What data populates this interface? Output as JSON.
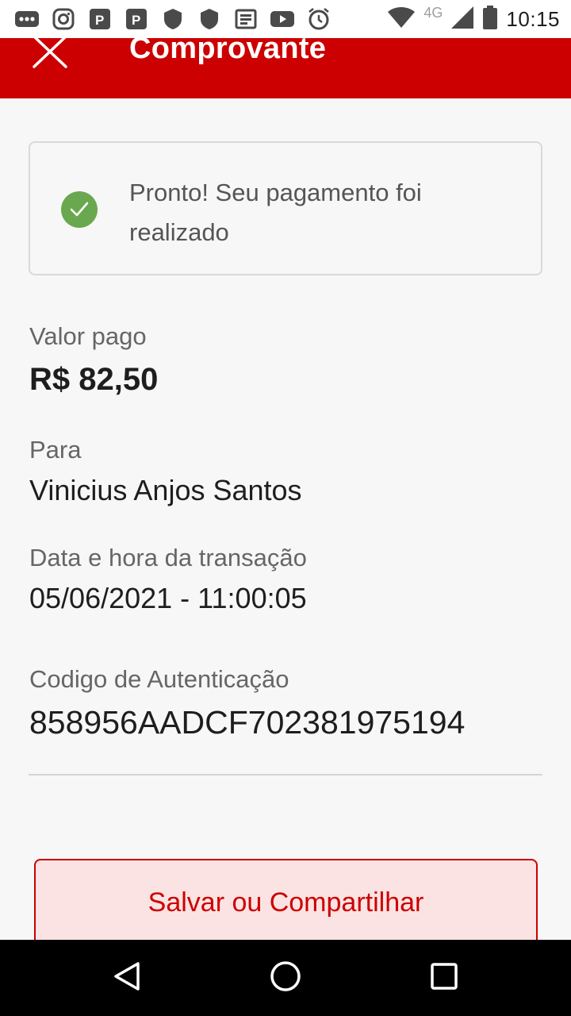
{
  "status_bar": {
    "time": "10:15",
    "network": "4G",
    "icons": [
      "more-dots-icon",
      "instagram-icon",
      "parking-icon",
      "parking-icon",
      "shield-icon",
      "shield-icon",
      "news-icon",
      "youtube-icon",
      "alarm-icon",
      "wifi-icon",
      "signal-icon",
      "battery-icon"
    ]
  },
  "header": {
    "title": "Comprovante",
    "close_icon": "close-icon",
    "color": "#cc0000"
  },
  "success": {
    "message": "Pronto! Seu pagamento foi realizado",
    "icon": "check-circle-icon",
    "icon_color": "#6aa84f"
  },
  "details": {
    "amount_label": "Valor pago",
    "amount_value": "R$ 82,50",
    "recipient_label": "Para",
    "recipient_value": "Vinicius Anjos Santos",
    "datetime_label": "Data e hora da transação",
    "datetime_value": "05/06/2021 - 11:00:05",
    "auth_label": "Codigo de Autenticação",
    "auth_value": "858956AADCF702381975194"
  },
  "actions": {
    "share_label": "Salvar ou Compartilhar"
  },
  "nav": {
    "back_icon": "back-triangle-icon",
    "home_icon": "home-circle-icon",
    "recents_icon": "recents-square-icon"
  }
}
